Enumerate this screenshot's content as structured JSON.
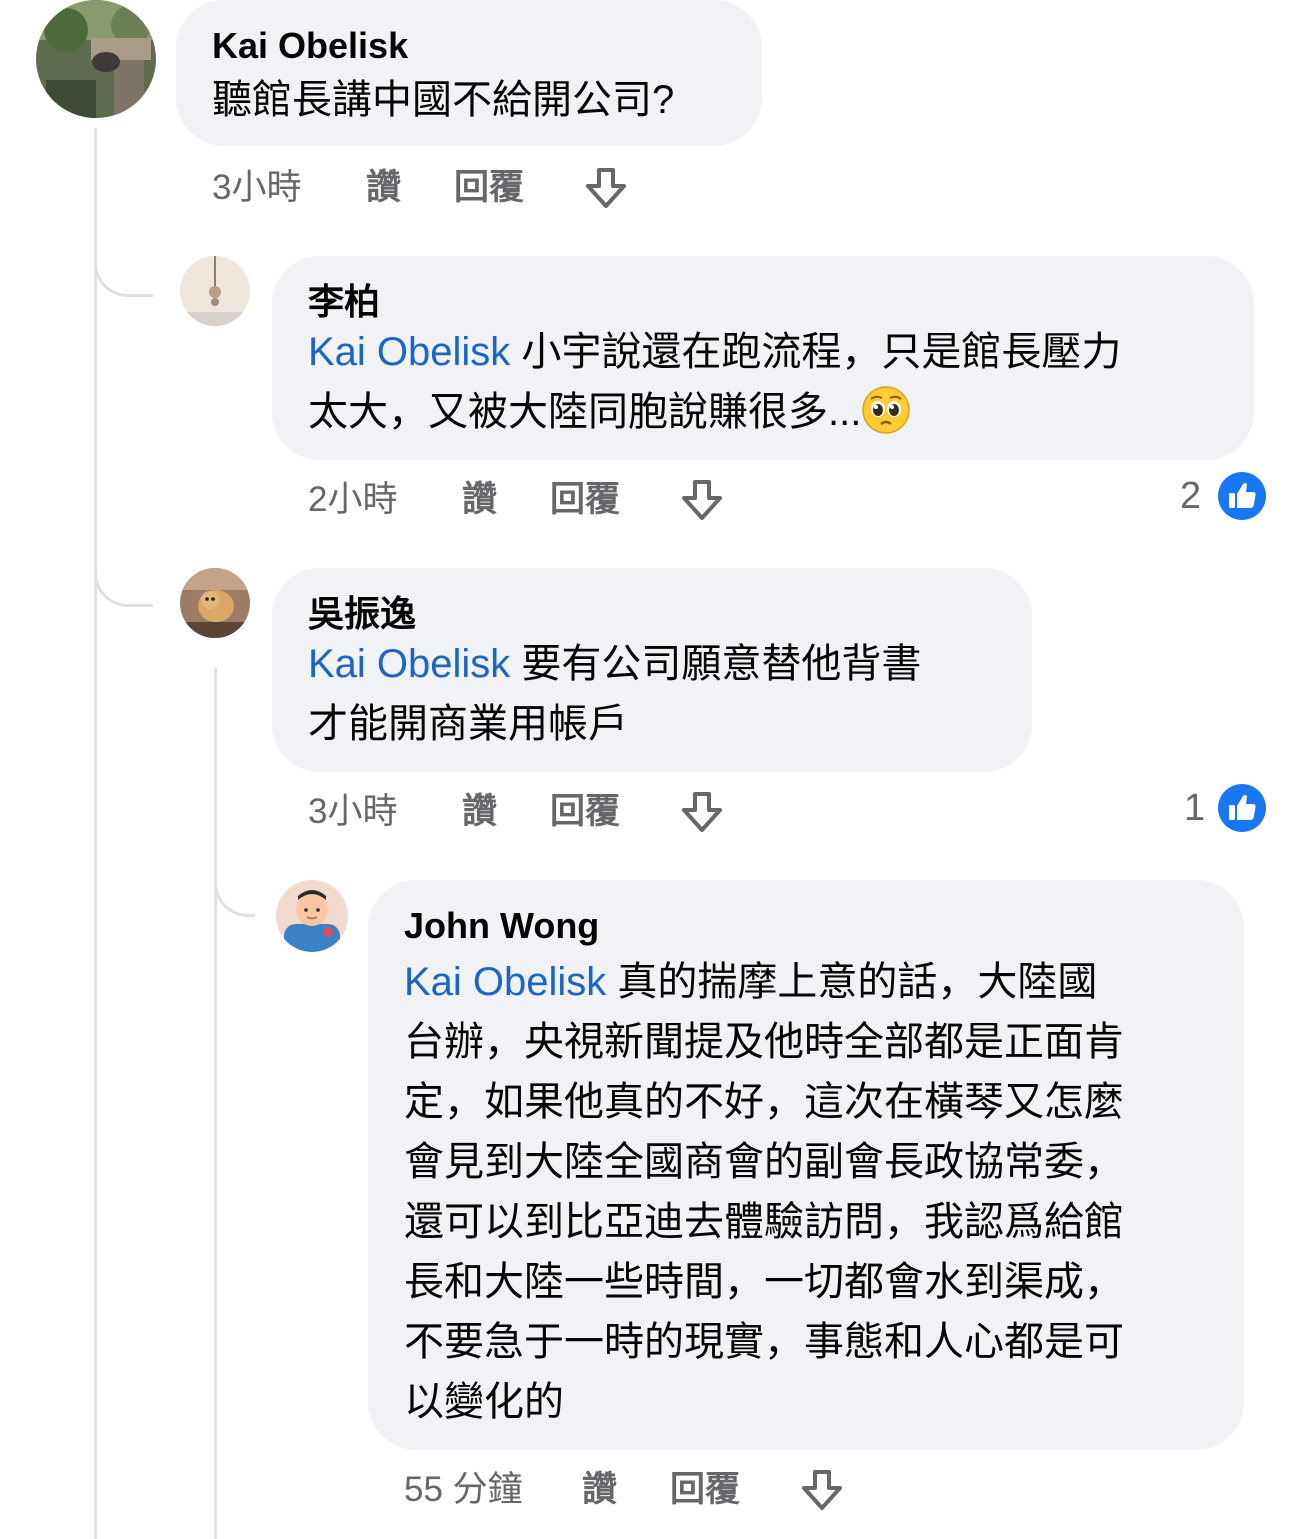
{
  "comments": [
    {
      "author": "Kai Obelisk",
      "lines": [
        "聽館長講中國不給開公司?"
      ],
      "time": "3小時",
      "like_label": "讚",
      "reply_label": "回覆",
      "avatar_icon": "photo-avatar-icon"
    },
    {
      "author": "李柏",
      "mention": "Kai Obelisk",
      "line1_text": " 小宇說還在跑流程，只是館長壓力",
      "line2_text": "太大，又被大陸同胞說賺很多...",
      "emoji": "pleading-face-emoji",
      "time": "2小時",
      "like_label": "讚",
      "reply_label": "回覆",
      "reaction_count": "2",
      "reaction_icon": "like-icon",
      "avatar_icon": "pendant-avatar-icon"
    },
    {
      "author": "吳振逸",
      "mention": "Kai Obelisk",
      "line1_text": " 要有公司願意替他背書",
      "line2_text": "才能開商業用帳戶",
      "time": "3小時",
      "like_label": "讚",
      "reply_label": "回覆",
      "reaction_count": "1",
      "reaction_icon": "like-icon",
      "avatar_icon": "cat-avatar-icon"
    },
    {
      "author": "John Wong",
      "mention": "Kai Obelisk",
      "line1_text": " 真的揣摩上意的話，大陸國",
      "lines": [
        "台辦，央視新聞提及他時全部都是正面肯",
        "定，如果他真的不好，這次在橫琴又怎麼",
        "會見到大陸全國商會的副會長政協常委，",
        "還可以到比亞迪去體驗訪問，我認爲給館",
        "長和大陸一些時間，一切都會水到渠成，",
        "不要急于一時的現實，事態和人心都是可",
        "以變化的"
      ],
      "time": "55 分鐘",
      "like_label": "讚",
      "reply_label": "回覆",
      "avatar_icon": "cartoon-man-avatar-icon"
    }
  ],
  "colors": {
    "bubble": "#f0f2f5",
    "mention": "#1b65c4",
    "meta": "#65676b",
    "like_badge": "#1877f2",
    "thread_line": "#dfe1e5"
  }
}
